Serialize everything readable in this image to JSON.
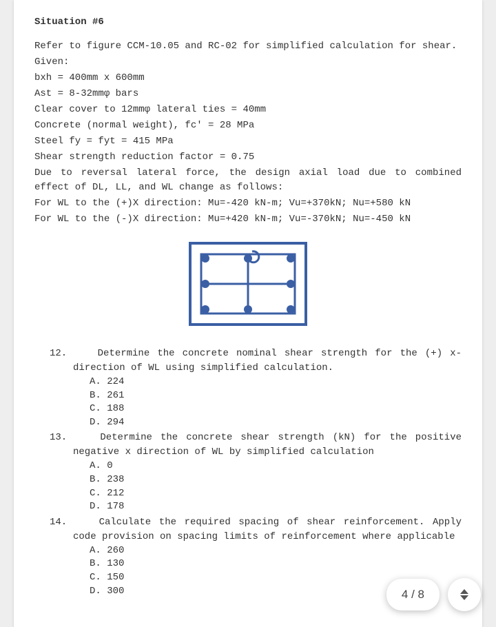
{
  "title": "Situation #6",
  "body": {
    "l1": "Refer to figure CCM-10.05 and RC-02 for simplified calculation for shear.",
    "l2": "Given:",
    "l3": "bxh = 400mm x 600mm",
    "l4": "Ast = 8-32mmφ bars",
    "l5": "Clear cover to 12mmφ lateral ties = 40mm",
    "l6": "Concrete (normal weight), fc' = 28 MPa",
    "l7": "Steel fy = fyt = 415 MPa",
    "l8": "Shear strength reduction factor = 0.75",
    "l9": "Due to reversal lateral force, the design axial load due to combined effect of DL, LL, and WL change as follows:",
    "l10": "For WL to the (+)X direction: Mu=-420 kN-m; Vu=+370kN; Nu=+580 kN",
    "l11": "For WL to the (-)X direction: Mu=+420 kN-m; Vu=-370kN; Nu=-450 kN"
  },
  "questions": [
    {
      "num": "12.",
      "text": "Determine the concrete nominal shear strength for the (+) x- direction of WL using simplified calculation.",
      "opts": {
        "A": "A. 224",
        "B": "B. 261",
        "C": "C. 188",
        "D": "D. 294"
      }
    },
    {
      "num": "13.",
      "text": "Determine the concrete shear strength (kN) for the positive negative x direction of WL by simplified calculation",
      "opts": {
        "A": "A. 0",
        "B": "B. 238",
        "C": "C. 212",
        "D": "D. 178"
      }
    },
    {
      "num": "14.",
      "text": "Calculate the required spacing of shear reinforcement. Apply code provision on spacing limits of reinforcement where applicable",
      "opts": {
        "A": "A. 260",
        "B": "B. 130",
        "C": "C. 150",
        "D": "D. 300"
      }
    }
  ],
  "pager": {
    "label": "4 / 8"
  }
}
